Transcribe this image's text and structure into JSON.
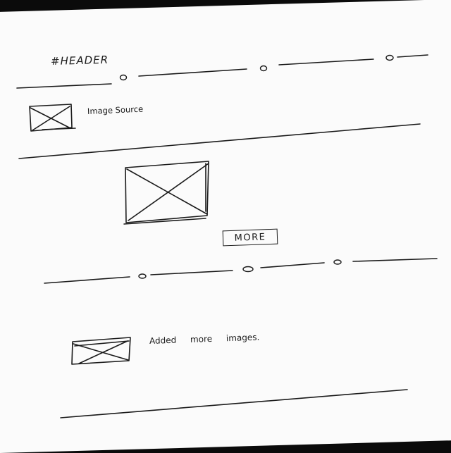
{
  "header": {
    "title": "#HEADER"
  },
  "item_one": {
    "caption": "Image Source"
  },
  "featured": {
    "more_label": "MORE"
  },
  "item_two": {
    "caption": "Added more images."
  }
}
